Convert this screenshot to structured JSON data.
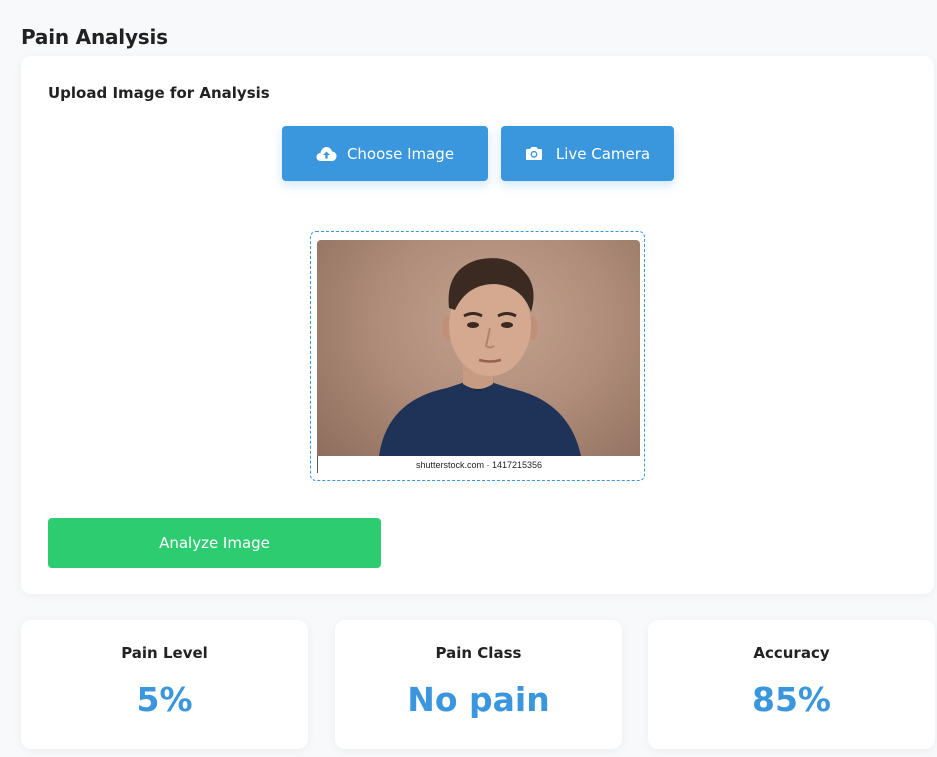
{
  "page": {
    "title": "Pain Analysis"
  },
  "upload": {
    "heading": "Upload Image for Analysis",
    "choose_label": "Choose Image",
    "camera_label": "Live Camera",
    "choose_icon": "cloud-upload-icon",
    "camera_icon": "camera-icon",
    "analyze_label": "Analyze Image",
    "preview_watermark": "shutterstock.com · 1417215356"
  },
  "stats": [
    {
      "label": "Pain Level",
      "value": "5%"
    },
    {
      "label": "Pain Class",
      "value": "No pain"
    },
    {
      "label": "Accuracy",
      "value": "85%"
    }
  ],
  "colors": {
    "accent": "#3a96dd",
    "analyze": "#2ecc71",
    "background": "#f8f9fb",
    "card": "#ffffff"
  }
}
